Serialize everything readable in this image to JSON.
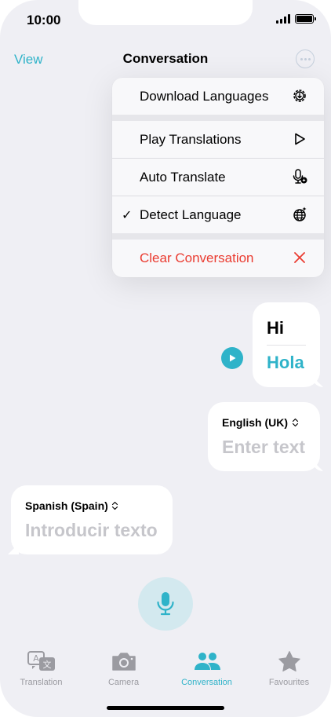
{
  "status": {
    "time": "10:00"
  },
  "nav": {
    "left": "View",
    "title": "Conversation",
    "more_icon": "ellipsis-circle-icon"
  },
  "menu": {
    "download": {
      "label": "Download Languages",
      "icon": "gear-download-icon"
    },
    "play": {
      "label": "Play Translations",
      "icon": "play-outline-icon"
    },
    "auto": {
      "label": "Auto Translate",
      "icon": "mic-translate-icon"
    },
    "detect": {
      "label": "Detect Language",
      "icon": "globe-sparkle-icon",
      "checked": true,
      "check": "✓"
    },
    "clear": {
      "label": "Clear Conversation",
      "icon": "close-icon"
    }
  },
  "conversation": {
    "message": {
      "source": "Hi",
      "translation": "Hola"
    },
    "english": {
      "language": "English (UK)",
      "placeholder": "Enter text"
    },
    "spanish": {
      "language": "Spanish (Spain)",
      "placeholder": "Introducir texto"
    }
  },
  "tabs": [
    {
      "label": "Translation",
      "icon": "translate-icon",
      "active": false
    },
    {
      "label": "Camera",
      "icon": "camera-icon",
      "active": false
    },
    {
      "label": "Conversation",
      "icon": "people-icon",
      "active": true
    },
    {
      "label": "Favourites",
      "icon": "star-icon",
      "active": false
    }
  ],
  "colors": {
    "accent": "#2fb3c9",
    "danger": "#ea3b30",
    "background": "#efeff4",
    "placeholder": "#c6c6cb"
  }
}
